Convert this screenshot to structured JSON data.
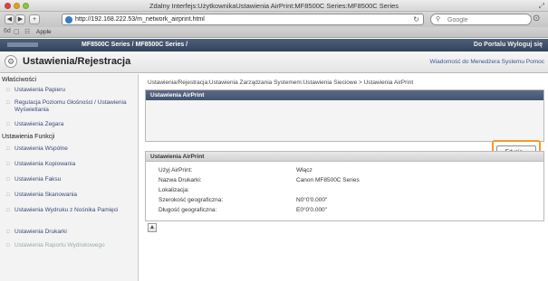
{
  "window": {
    "title": "Zdalny Interfejs:UżytkownikaUstawienia AirPrint:MF8500C Series:MF8500C Series"
  },
  "browser": {
    "url": "http://192.168.222.53/m_network_airprint.html",
    "search_placeholder": "Google",
    "bookmark_apple": "Apple"
  },
  "device": {
    "name": "MF8500C Series / MF8500C Series /",
    "logout": "Do Portalu  Wyloguj się"
  },
  "page": {
    "title": "Ustawienia/Rejestracja",
    "links": "Wiadomość do Menedżera Systemu  Pomoc"
  },
  "sidebar": {
    "sections": [
      {
        "label": "Właściwości"
      },
      {
        "label": "Ustawienia Funkcji"
      }
    ],
    "items": [
      {
        "label": "Ustawienia Papieru"
      },
      {
        "label": "Regulacja Poziomu Głośności / Ustawienia Wyświetlania"
      },
      {
        "label": "Ustawienia Zegara"
      },
      {
        "label": "Ustawienia Wspólne"
      },
      {
        "label": "Ustawienia Kopiowania"
      },
      {
        "label": "Ustawienia Faksu"
      },
      {
        "label": "Ustawienia Skanowania"
      },
      {
        "label": "Ustawienia Wydruku z Nośnika Pamięci"
      },
      {
        "label": "Ustawienia Drukarki"
      },
      {
        "label": "Ustawienia Raportu Wydrukowego"
      }
    ]
  },
  "main": {
    "breadcrumb": "Ustawienia/Rejestracja:Ustawienia Zarządzania Systemem:Ustawienia Sieciowe > Ustawienia AirPrint",
    "panel1_title": "Ustawienia AirPrint",
    "edit_label": "Edycja...",
    "panel2_title": "Ustawienia AirPrint",
    "rows": [
      {
        "label": "Użyj AirPrint:",
        "value": "Włącz"
      },
      {
        "label": "Nazwa Drukarki:",
        "value": "Canon MF8500C Series"
      },
      {
        "label": "Lokalizacja:",
        "value": ""
      },
      {
        "label": "Szerokość geograficzna:",
        "value": "N0°0'0.000\""
      },
      {
        "label": "Długość geograficzna:",
        "value": "E0°0'0.000\""
      }
    ]
  }
}
